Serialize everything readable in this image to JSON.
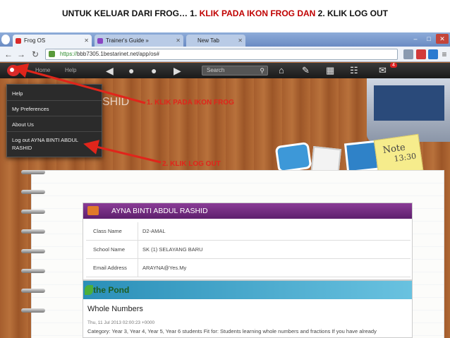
{
  "slide": {
    "title_prefix": "UNTUK KELUAR DARI FROG… 1.",
    "title_highlight": " KLIK PADA IKON FROG DAN",
    "title_suffix": "  2. KLIK LOG OUT"
  },
  "browser": {
    "tabs": [
      {
        "label": "Frog OS",
        "active": true
      },
      {
        "label": "Trainer's Guide »",
        "active": false
      },
      {
        "label": "New Tab",
        "active": false
      }
    ],
    "url_scheme": "https://",
    "url_rest": "bbb7305.1bestarinet.net/app/os#"
  },
  "frogbar": {
    "home_label": "Home",
    "help_label": "Help",
    "search_placeholder": "Search",
    "notification_count": "4"
  },
  "dropdown": {
    "items": [
      "Help",
      "My Preferences",
      "About Us",
      "Log out AYNA BINTI ABDUL",
      "RASHID"
    ]
  },
  "desktop": {
    "bg_name_fragment": "SHID",
    "note_word": "Note",
    "note_time": "13:30"
  },
  "profile": {
    "name": "AYNA BINTI ABDUL RASHID",
    "rows": [
      {
        "label": "Class Name",
        "value": "D2-AMAL"
      },
      {
        "label": "School Name",
        "value": "SK (1) SELAYANG BARU"
      },
      {
        "label": "Email Address",
        "value": "ARAYNA@Yes.My"
      }
    ]
  },
  "pond": {
    "banner": "the Pond",
    "title": "Whole Numbers",
    "date": "Thu, 11 Jul 2013 02:00:23 +0000",
    "category": "Category: Year 3, Year 4, Year 5, Year 6 students Fit for: Students learning whole numbers and fractions If you have already"
  },
  "annotations": {
    "step1": "1. KLIK PADA IKON FROG",
    "step2": "2. KLIK LOG OUT",
    "color": "#e0251b"
  }
}
